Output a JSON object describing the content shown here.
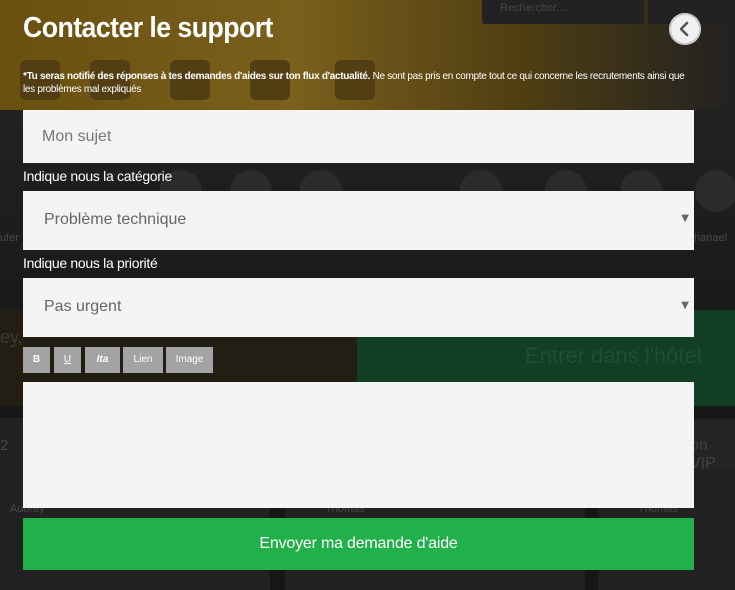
{
  "background": {
    "search_text": "Rechercher...",
    "enter_hotel": "Entrer dans l'hôtel",
    "vip_text": "on VIP",
    "left_text": "ey,",
    "side_left": "uter",
    "side_right": "hanael",
    "card_names": [
      "Aubrey",
      "Thomas",
      "Thomas"
    ],
    "number_left": "2"
  },
  "modal": {
    "title": "Contacter le support",
    "back_icon": "chevron-left-icon",
    "notice_bold": "*Tu seras notifié des réponses à tes demandes d'aides sur ton flux d'actualité.",
    "notice_rest": " Ne sont pas pris en compte tout ce qui concerne les recrutements ainsi que les problèmes mal expliqués",
    "subject_placeholder": "Mon sujet",
    "category_label": "Indique nous la catégorie",
    "category_value": "Problème technique",
    "priority_label": "Indique nous la priorité",
    "priority_value": "Pas urgent",
    "toolbar": {
      "bold": "B",
      "underline": "U",
      "italic": "Ita",
      "link": "Lien",
      "image": "Image"
    },
    "message_value": "",
    "submit_label": "Envoyer ma demande d'aide"
  },
  "colors": {
    "submit_green": "#22b04b",
    "field_bg": "#f4f4f4",
    "toolbar_btn": "#a3a3a3"
  }
}
